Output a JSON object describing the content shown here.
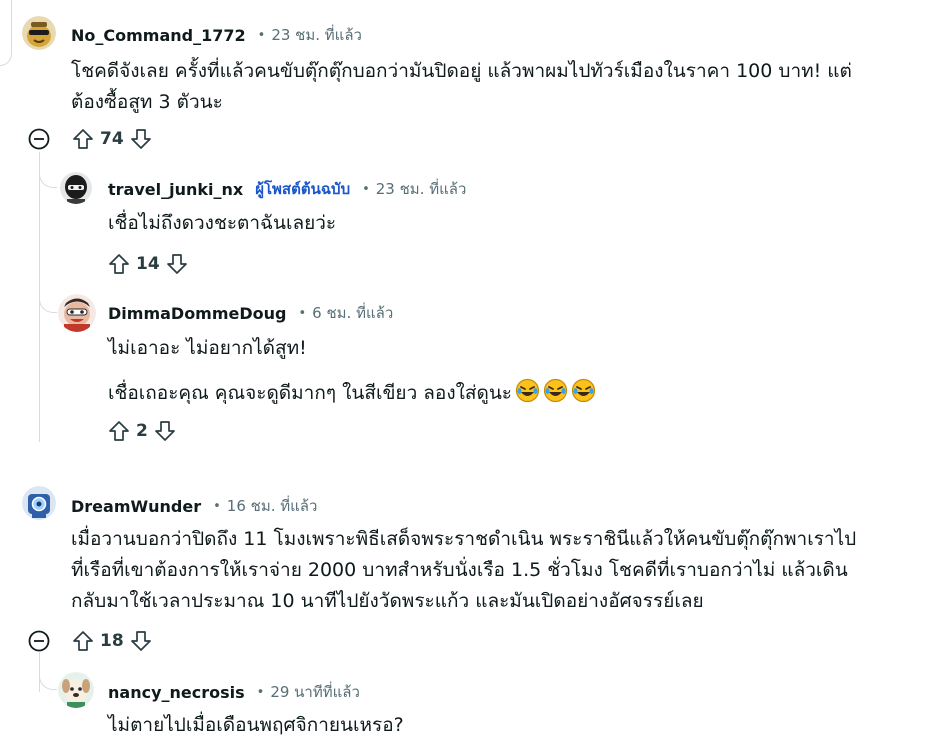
{
  "comments": [
    {
      "username": "No_Command_1772",
      "time": "23 ชม. ที่แล้ว",
      "body": [
        "โชคดีจังเลย ครั้งที่แล้วคนขับตุ๊กตุ๊กบอกว่ามันปิดอยู่ แล้วพาผมไปทัวร์เมืองในราคา 100 บาท! แต่",
        "ต้องซื้อสูท 3 ตัวนะ"
      ],
      "votes": "74",
      "replies": [
        {
          "username": "travel_junki_nx",
          "op_tag": "ผู้โพสต์ต้นฉบับ",
          "time": "23 ชม. ที่แล้ว",
          "body": [
            "เชื่อไม่ถึงดวงชะตาฉันเลยว่ะ"
          ],
          "votes": "14"
        },
        {
          "username": "DimmaDommeDoug",
          "time": "6 ชม. ที่แล้ว",
          "body": [
            "ไม่เอาอะ ไม่อยากได้สูท!",
            "เชื่อเถอะคุณ คุณจะดูดีมากๆ ในสีเขียว ลองใส่ดูนะ"
          ],
          "emoji": "rofl-emoji",
          "votes": "2"
        }
      ]
    },
    {
      "username": "DreamWunder",
      "time": "16 ชม. ที่แล้ว",
      "body": [
        "เมื่อวานบอกว่าปิดถึง 11 โมงเพราะพิธีเสด็จพระราชดำเนิน พระราชินีแล้วให้คนขับตุ๊กตุ๊กพาเราไป",
        "ที่เรือที่เขาต้องการให้เราจ่าย 2000 บาทสำหรับนั่งเรือ 1.5 ชั่วโมง โชคดีที่เราบอกว่าไม่ แล้วเดิน",
        "กลับมาใช้เวลาประมาณ 10 นาทีไปยังวัดพระแก้ว และมันเปิดอย่างอัศจรรย์เลย"
      ],
      "votes": "18",
      "replies": [
        {
          "username": "nancy_necrosis",
          "time": "29 นาทีที่แล้ว",
          "body": [
            "ไม่ตายไปเมื่อเดือนพฤศจิกายนเหรอ?"
          ]
        }
      ]
    }
  ],
  "icons": {
    "upvote": "arrow-up-icon",
    "downvote": "arrow-down-icon",
    "collapse": "minus-circle-icon"
  },
  "colors": {
    "op_tag": "#1a56c9",
    "meta": "#576f76",
    "thread_line": "#d5dde0"
  }
}
